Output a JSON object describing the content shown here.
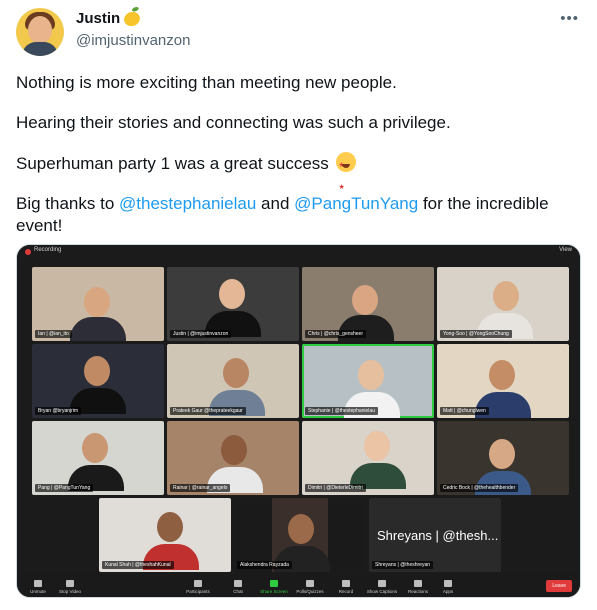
{
  "author": {
    "display_name": "Justin",
    "handle": "@imjustinvanzon"
  },
  "tweet": {
    "line1": "Nothing is more exciting than meeting new people.",
    "line2": "Hearing their stories and connecting was such a privilege.",
    "line3": "Superhuman party 1 was a great success",
    "line4_pre": "Big thanks to ",
    "mention1": "@thestephanielau",
    "line4_mid": " and ",
    "mention2": "@PangTunYang",
    "line4_post": " for the incredible event!"
  },
  "zoom": {
    "recording_label": "Recording",
    "view_label": "View",
    "participants": [
      {
        "label": "Ian | @ian_ito"
      },
      {
        "label": "Justin | @imjustinvanzon"
      },
      {
        "label": "Chris | @chris_gensheer"
      },
      {
        "label": "Yong-Soo | @YongSooChung"
      },
      {
        "label": "Bryan @bryanjrim"
      },
      {
        "label": "Prateek Gaur @theprateekgaur"
      },
      {
        "label": "Stephanie | @thestephanielau"
      },
      {
        "label": "Matt | @chunglwen"
      },
      {
        "label": "Pang | @PangTunYang"
      },
      {
        "label": "Rainar | @rainar_angelo"
      },
      {
        "label": "Dimitri | @DieterleDimitri"
      },
      {
        "label": "Cedric Bock | @thehealthbender"
      },
      {
        "label": "Kunal Shah | @theshahKunal"
      },
      {
        "label": "Alakshendra Rayzada"
      },
      {
        "label": "Shreyans | @theshreyan"
      }
    ],
    "text_tile_name": "Shreyans | @thesh...",
    "toolbar": {
      "unmute": "Unmute",
      "stop_video": "Stop Video",
      "participants": "Participants",
      "chat": "Chat",
      "share_screen": "Share Screen",
      "polls": "Polls/Quizzes",
      "record": "Record",
      "captions": "Show Captions",
      "reactions": "Reactions",
      "apps": "Apps",
      "leave": "Leave"
    }
  }
}
